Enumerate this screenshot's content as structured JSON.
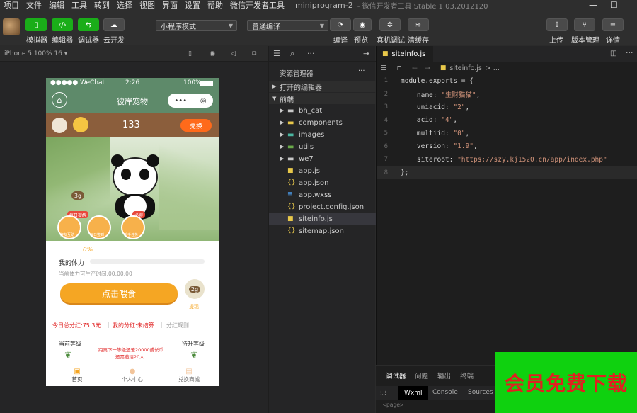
{
  "menu": {
    "items": [
      "项目",
      "文件",
      "编辑",
      "工具",
      "转到",
      "选择",
      "视图",
      "界面",
      "设置",
      "帮助",
      "微信开发者工具"
    ],
    "project": "miniprogram-2",
    "subtitle": "- 微信开发者工具 Stable 1.03.2012120",
    "window_buttons": [
      "—",
      "☐"
    ]
  },
  "toolbar": {
    "simulator": "模拟器",
    "editor": "编辑器",
    "debugger": "调试器",
    "cloud": "云开发",
    "mode_select": "小程序模式",
    "compile_select": "普通编译",
    "compile": "编译",
    "preview": "预览",
    "real_debug": "真机调试",
    "clear_cache": "清缓存",
    "upload": "上传",
    "version": "版本管理",
    "details": "详情"
  },
  "simulator": {
    "device": "iPhone 5 100% 16 ▾"
  },
  "phone": {
    "carrier": "●●●●● WeChat",
    "time": "2:26",
    "battery": "100%",
    "nav_title": "彼岸宠物",
    "coins": "133",
    "redeem": "兑换",
    "bamboo_badge": "3g",
    "action_tag_1": "每日提醒",
    "action_tag_2": "必得",
    "actions": [
      "好友互助",
      "每日签到",
      "新手任务"
    ],
    "progress": "0%",
    "stamina_label": "我的体力",
    "countdown": "当前体力可生产时间:00:00:00",
    "feed_button": "点击喂食",
    "bamboo_count": "2g",
    "bamboo_label": "提现",
    "bonus_today": "今日总分红:75.3元",
    "my_bonus": "我的分红:未结算",
    "bonus_rules": "分红规则",
    "current_level": "当前等级",
    "upgrade_hint": "距离下一等级还差20000成长币",
    "upgrade_hint2": "还需邀请20人",
    "next_level": "待升等级",
    "tabs": [
      "首页",
      "个人中心",
      "兑换商城"
    ]
  },
  "explorer": {
    "title": "资源管理器",
    "more": "···",
    "open_editors": "打开的编辑器",
    "root": "前端",
    "folders": [
      "bh_cat",
      "components",
      "images",
      "utils",
      "we7"
    ],
    "files": [
      "app.js",
      "app.json",
      "app.wxss",
      "project.config.json",
      "siteinfo.js",
      "sitemap.json"
    ]
  },
  "editor": {
    "tab": "siteinfo.js",
    "breadcrumb_file": "siteinfo.js",
    "breadcrumb_more": "> ...",
    "code": [
      {
        "n": "1",
        "pre": "module.exports = {",
        "val": "",
        "post": ""
      },
      {
        "n": "2",
        "pre": "    name: ",
        "val": "\"生财猫猫\"",
        "post": ","
      },
      {
        "n": "3",
        "pre": "    uniacid: ",
        "val": "\"2\"",
        "post": ","
      },
      {
        "n": "4",
        "pre": "    acid: ",
        "val": "\"4\"",
        "post": ","
      },
      {
        "n": "5",
        "pre": "    multiid: ",
        "val": "\"0\"",
        "post": ","
      },
      {
        "n": "6",
        "pre": "    version: ",
        "val": "\"1.9\"",
        "post": ","
      },
      {
        "n": "7",
        "pre": "    siteroot: ",
        "val": "\"https://szy.kj1520.cn/app/index.php\"",
        "post": ""
      },
      {
        "n": "8",
        "pre": "};",
        "val": "",
        "post": ""
      }
    ]
  },
  "debug": {
    "tabs": [
      "调试器",
      "问题",
      "输出",
      "终端"
    ],
    "subtabs": [
      "Wxml",
      "Console",
      "Sources"
    ],
    "content": "<page>"
  },
  "promo": {
    "text": "会员免费下载"
  },
  "colors": {
    "green": "#1aad19",
    "orange": "#f5a623",
    "promo_bg": "#0fd10f",
    "promo_text": "#e02020"
  }
}
